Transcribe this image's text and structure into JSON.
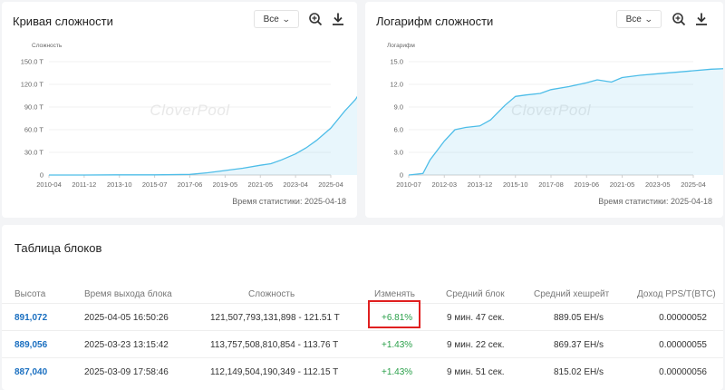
{
  "difficulty_chart": {
    "title": "Кривая сложности",
    "range_label": "Все",
    "ylabel": "Сложность",
    "stat_time": "Время статистики: 2025-04-18",
    "watermark": "CloverPool",
    "chart_data": {
      "type": "area",
      "title": "Кривая сложности",
      "ylabel": "Сложность",
      "xlabel": "",
      "ytick_labels": [
        "0",
        "30.0 T",
        "60.0 T",
        "90.0 T",
        "120.0 T",
        "150.0 T"
      ],
      "ylim": [
        0,
        150
      ],
      "x_tick_labels": [
        "2010-04",
        "2011-12",
        "2013-10",
        "2015-07",
        "2017-06",
        "2019-05",
        "2021-05",
        "2023-04",
        "2025-04"
      ],
      "x": [
        0,
        1,
        2,
        3,
        4,
        4.5,
        5,
        5.5,
        6,
        6.3,
        6.6,
        7,
        7.3,
        7.6,
        8,
        8.4,
        8.7,
        9
      ],
      "values": [
        0,
        0.05,
        0.2,
        0.3,
        0.9,
        3,
        6,
        9,
        13,
        15,
        20,
        28,
        36,
        46,
        62,
        85,
        100,
        121.5
      ],
      "color": "#4dbde8"
    }
  },
  "log_chart": {
    "title": "Логарифм сложности",
    "range_label": "Все",
    "ylabel": "Логарифм",
    "stat_time": "Время статистики: 2025-04-18",
    "watermark": "CloverPool",
    "chart_data": {
      "type": "area",
      "title": "Логарифм сложности",
      "ylabel": "Логарифм",
      "xlabel": "",
      "ytick_labels": [
        "0",
        "3.0",
        "6.0",
        "9.0",
        "12.0",
        "15.0"
      ],
      "ylim": [
        0,
        15
      ],
      "x_tick_labels": [
        "2010-07",
        "2012-03",
        "2013-12",
        "2015-10",
        "2017-08",
        "2019-06",
        "2021-05",
        "2023-05",
        "2025-04"
      ],
      "x": [
        0,
        0.4,
        0.6,
        1.0,
        1.3,
        1.6,
        2.0,
        2.3,
        2.7,
        3.0,
        3.3,
        3.7,
        4.0,
        4.5,
        5.0,
        5.3,
        5.7,
        6.0,
        6.5,
        7.0,
        7.5,
        8.0,
        8.5,
        9.0
      ],
      "values": [
        0,
        0.2,
        2,
        4.5,
        6,
        6.3,
        6.5,
        7.3,
        9.2,
        10.4,
        10.6,
        10.8,
        11.3,
        11.7,
        12.2,
        12.6,
        12.3,
        12.9,
        13.2,
        13.4,
        13.6,
        13.8,
        14.0,
        14.1
      ],
      "color": "#4dbde8"
    }
  },
  "table": {
    "title": "Таблица блоков",
    "headers": [
      "Высота",
      "Время выхода блока",
      "Сложность",
      "Изменять",
      "Средний блок",
      "Средний хешрейт",
      "Доход PPS/T(BTC)"
    ],
    "rows": [
      [
        "891,072",
        "2025-04-05 16:50:26",
        "121,507,793,131,898 - 121.51 T",
        "+6.81%",
        "9 мин. 47 сек.",
        "889.05 EH/s",
        "0.00000052"
      ],
      [
        "889,056",
        "2025-03-23 13:15:42",
        "113,757,508,810,854 - 113.76 T",
        "+1.43%",
        "9 мин. 22 сек.",
        "869.37 EH/s",
        "0.00000055"
      ],
      [
        "887,040",
        "2025-03-09 17:58:46",
        "112,149,504,190,349 - 112.15 T",
        "+1.43%",
        "9 мин. 51 сек.",
        "815.02 EH/s",
        "0.00000056"
      ]
    ]
  }
}
